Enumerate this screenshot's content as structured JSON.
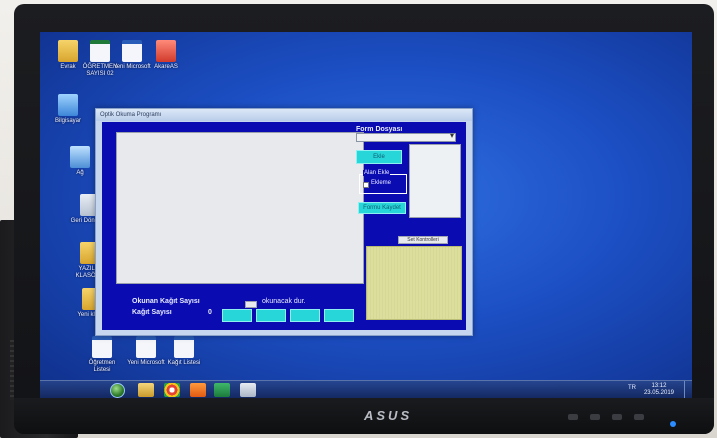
{
  "desktop": {
    "icons": [
      {
        "label": "Evrak"
      },
      {
        "label": "ÖĞRETMEN SAYISI 02"
      },
      {
        "label": "Yeni Microsoft"
      },
      {
        "label": "AkareAS"
      },
      {
        "label": "Bilgisayar"
      },
      {
        "label": "Ağ"
      },
      {
        "label": "Geri Dönüşüm"
      },
      {
        "label": "YAZILIM KLASÖRÜ"
      },
      {
        "label": "Yeni klasör"
      },
      {
        "label": "Öğretmen Listesi"
      },
      {
        "label": "Yeni Microsoft"
      },
      {
        "label": "Kağıt Listesi"
      }
    ]
  },
  "app": {
    "title": "Optik Okuma Programı",
    "form_label": "Form Dosyası",
    "btn_ekle": "Ekle",
    "groupbox_title": "Alan Ekle",
    "checkbox_label": "Ekleme",
    "btn_form_kaydet": "Formu Kaydet",
    "btn_set_control": "Set Kontrolleri",
    "okunan_label": "Okunan Kağıt Sayısı",
    "okunacak_label": "okunacak dur.",
    "kagit_label": "Kağıt Sayısı",
    "kagit_value": "0"
  },
  "taskbar": {
    "tray_text": "TR",
    "clock_time": "13:12",
    "clock_date": "23.05.2019"
  },
  "monitor": {
    "brand": "ASUS"
  }
}
